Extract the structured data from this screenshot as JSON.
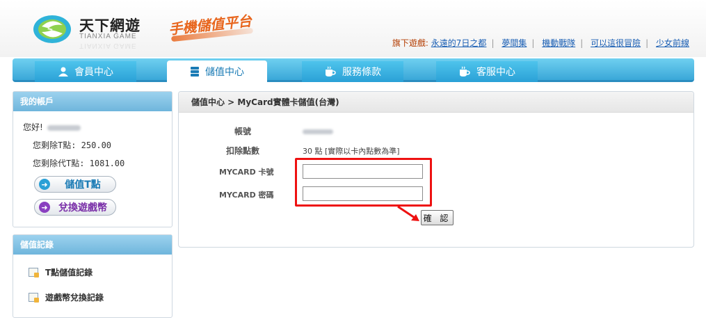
{
  "brand": {
    "name_cn": "天下網遊",
    "name_en": "TIANXIA GAME",
    "slogan": "手機儲值平台"
  },
  "games": {
    "label": "旗下遊戲:",
    "links": [
      "永遠的7日之都",
      "夢間集",
      "機動戰隊",
      "可以這很冒險",
      "少女前線"
    ]
  },
  "nav": {
    "tabs": [
      {
        "label": "會員中心",
        "icon": "person-icon"
      },
      {
        "label": "儲值中心",
        "icon": "server-icon"
      },
      {
        "label": "服務條款",
        "icon": "cup-icon"
      },
      {
        "label": "客服中心",
        "icon": "cup-icon"
      }
    ],
    "active_index": 1
  },
  "account": {
    "title": "我的帳戶",
    "greeting": "您好!",
    "t_points": "您剩除T點: 250.00",
    "d_points": "您剩除代T點: 1081.00",
    "btn_topup": "儲值T點",
    "btn_exchange": "兌換遊戲幣"
  },
  "records": {
    "title": "儲值記錄",
    "items": [
      "T點儲值記錄",
      "遊戲幣兌換記錄"
    ]
  },
  "main": {
    "breadcrumb": "儲值中心 > MyCard實體卡儲值(台灣)",
    "account_label": "帳號",
    "deduct_label": "扣除點數",
    "deduct_value": "30 點 [實際以卡內點數為準]",
    "card_no_label": "MYCARD 卡號",
    "card_pwd_label": "MYCARD 密碼",
    "card_no_value": "",
    "card_pwd_value": "",
    "confirm_label": "確 認"
  },
  "colors": {
    "nav": "#3aa7d8",
    "accent_red": "#e11111",
    "slogan": "#e8661e",
    "link": "#1a5fb4"
  }
}
